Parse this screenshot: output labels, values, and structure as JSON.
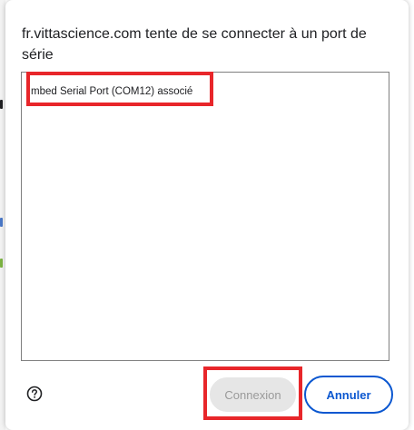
{
  "dialog": {
    "title": "fr.vittascience.com tente de se connecter à un port de série",
    "devices": [
      {
        "label": "mbed Serial Port (COM12) associé"
      }
    ],
    "help_icon": "help-circle-icon",
    "buttons": {
      "connect_label": "Connexion",
      "cancel_label": "Annuler"
    }
  },
  "colors": {
    "accent": "#0b57d0",
    "disabled_bg": "#e6e6e6",
    "disabled_text": "#9a9a9a",
    "highlight": "#e8262a"
  }
}
